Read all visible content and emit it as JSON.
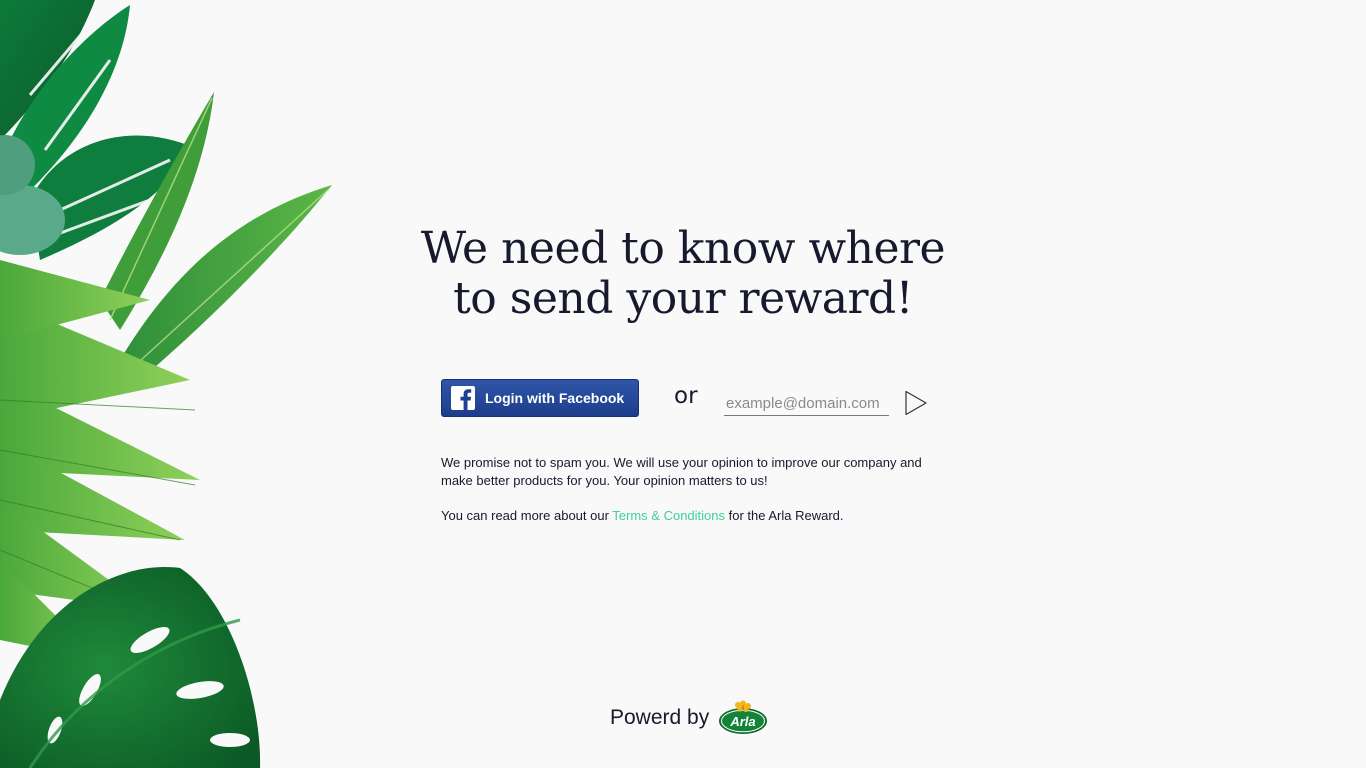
{
  "headline": {
    "line1": "We need to know where",
    "line2": "to send your reward!"
  },
  "facebook_button": {
    "label": "Login with Facebook",
    "icon": "facebook-icon",
    "color": "#1f3f8f"
  },
  "separator": "or",
  "email": {
    "value": "",
    "placeholder": "example@domain.com",
    "submit_icon": "play-arrow-icon"
  },
  "promise_text": "We promise not to spam you. We will use your opinion to improve our company and make better products for you. Your opinion matters to us!",
  "terms": {
    "prefix": "You can read more about our ",
    "link_label": "Terms & Conditions",
    "suffix": " for the Arla Reward.",
    "link_color": "#3fcf9a"
  },
  "footer": {
    "powered_label": "Powerd by",
    "logo_text": "Arla",
    "logo_icon": "arla-logo"
  },
  "decoration": {
    "foliage_icon": "tropical-leaves-illustration"
  }
}
